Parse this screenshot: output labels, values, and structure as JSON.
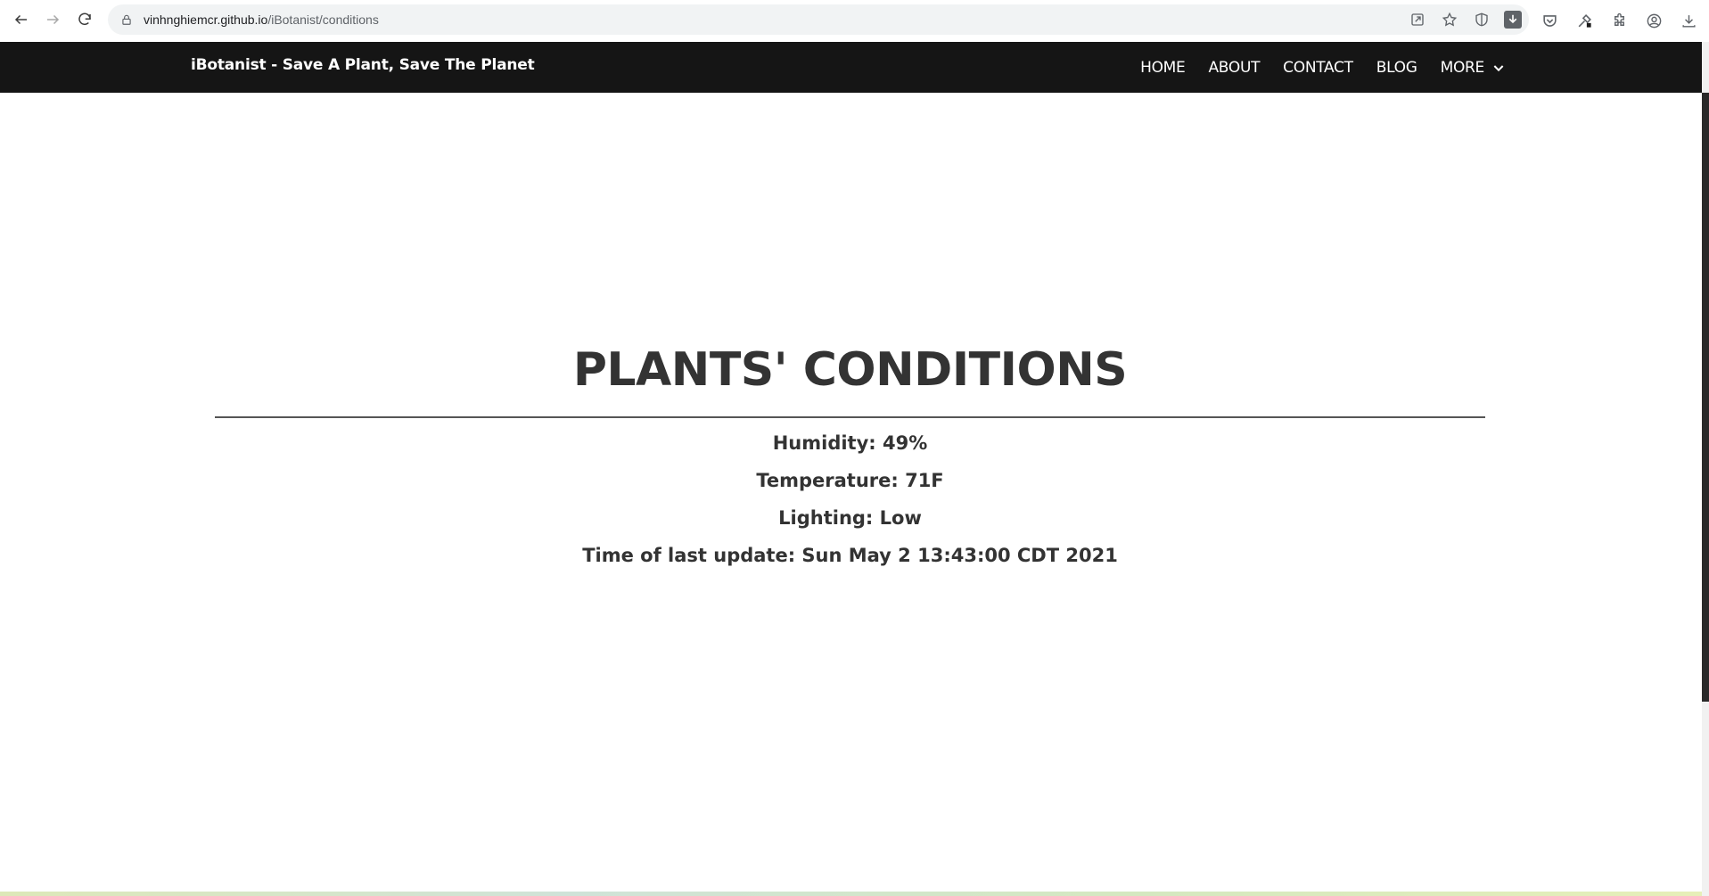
{
  "browser": {
    "url_host": "vinhnghiemcr.github.io",
    "url_path": "/iBotanist/conditions"
  },
  "site": {
    "title": "iBotanist - Save A Plant, Save The Planet",
    "nav": [
      {
        "label": "HOME"
      },
      {
        "label": "ABOUT"
      },
      {
        "label": "CONTACT"
      },
      {
        "label": "BLOG"
      },
      {
        "label": "MORE"
      }
    ]
  },
  "main": {
    "heading": "PLANTS' CONDITIONS",
    "conditions": [
      {
        "text": "Humidity: 49%"
      },
      {
        "text": "Temperature: 71F"
      },
      {
        "text": "Lighting: Low"
      },
      {
        "text": "Time of last update: Sun May 2 13:43:00 CDT 2021"
      }
    ]
  },
  "colors": {
    "header_bg": "#151515",
    "heading_text": "#333333"
  }
}
